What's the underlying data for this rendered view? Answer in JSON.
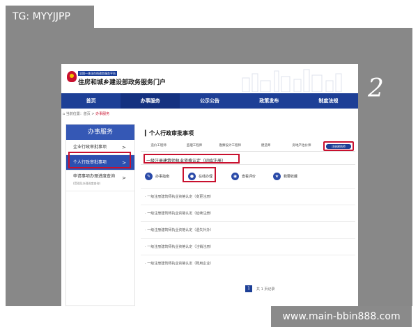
{
  "tag": "TG: MYYJJPP",
  "watermark": "www.main-bbin888.com",
  "handwritten_number": "2",
  "portal": {
    "badge": "全国一体化在线政务服务平台",
    "title": "住房和城乡建设部政务服务门户"
  },
  "nav": [
    "首页",
    "办事服务",
    "公示公告",
    "政策发布",
    "制度法规"
  ],
  "breadcrumb": {
    "prefix": "当前位置：首页 > ",
    "current": "办事服务"
  },
  "sidebar": {
    "header": "办事服务",
    "items": [
      {
        "label": "企业行政审批事项",
        "arrow": ">"
      },
      {
        "label": "个人行政审批事项",
        "arrow": ">"
      },
      {
        "label": "申请事项办理进度查询",
        "sub": "(受理及办理进度查询)",
        "arrow": ">"
      }
    ]
  },
  "main": {
    "title": "个人行政审批事项",
    "tabs": [
      "造价工程师",
      "监理工程师",
      "勘察设计工程师",
      "建造师",
      "房地产估价师",
      "注册建筑师"
    ],
    "section_title": "一级注册建筑师执业资格认定（初始注册）",
    "actions": [
      "办事指南",
      "在线办理",
      "查看评价",
      "我要收藏"
    ],
    "rows": [
      "一级注册建筑师执业资格认定（变更注册）",
      "一级注册建筑师执业资格认定（延续注册）",
      "一级注册建筑师执业资格认定（遗失补办）",
      "一级注册建筑师执业资格认定（注销注册）",
      "一级注册建筑师执业资格认定（聘用企业）"
    ],
    "pager": {
      "current_page": "1",
      "summary": "共 1 页记录"
    }
  },
  "colors": {
    "nav_blue": "#1d3f96",
    "highlight_red": "#c8102e",
    "frame_gray": "#888888"
  }
}
